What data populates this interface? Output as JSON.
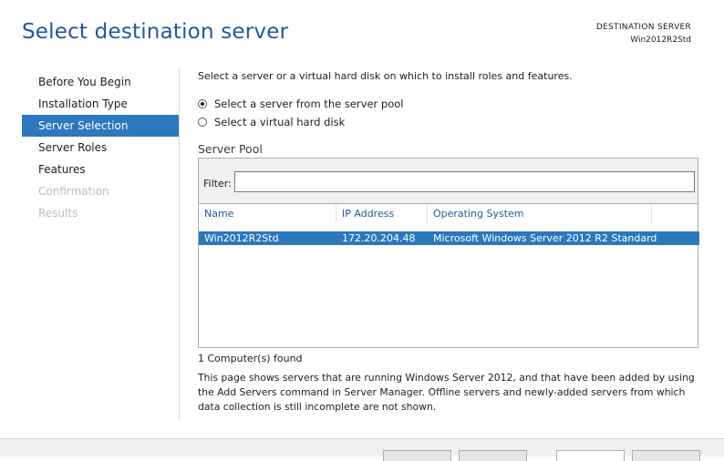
{
  "page": {
    "title": "Select destination server"
  },
  "destination": {
    "label": "DESTINATION SERVER",
    "server": "Win2012R2Std"
  },
  "sidebar": {
    "items": [
      {
        "label": "Before You Begin",
        "state": "normal"
      },
      {
        "label": "Installation Type",
        "state": "normal"
      },
      {
        "label": "Server Selection",
        "state": "selected"
      },
      {
        "label": "Server Roles",
        "state": "normal"
      },
      {
        "label": "Features",
        "state": "normal"
      },
      {
        "label": "Confirmation",
        "state": "disabled"
      },
      {
        "label": "Results",
        "state": "disabled"
      }
    ]
  },
  "content": {
    "intro": "Select a server or a virtual hard disk on which to install roles and features.",
    "options": [
      {
        "label": "Select a server from the server pool",
        "checked": true
      },
      {
        "label": "Select a virtual hard disk",
        "checked": false
      }
    ],
    "pool_title": "Server Pool",
    "filter": {
      "label": "Filter:",
      "value": ""
    },
    "columns": [
      "Name",
      "IP Address",
      "Operating System"
    ],
    "rows": [
      {
        "name": "Win2012R2Std",
        "ip": "172.20.204.48",
        "os": "Microsoft Windows Server 2012 R2 Standard"
      }
    ],
    "count": "1 Computer(s) found",
    "description": "This page shows servers that are running Windows Server 2012, and that have been added by using the Add Servers command in Server Manager. Offline servers and newly-added servers from which data collection is still incomplete are not shown."
  },
  "colors": {
    "accent": "#2d77bf",
    "title": "#1e5aa0",
    "disabled": "#bdbdbd"
  }
}
